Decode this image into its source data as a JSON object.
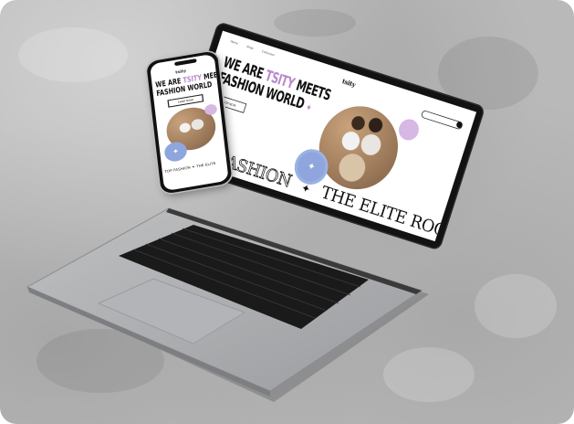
{
  "scene": {
    "description_free": true,
    "colors": {
      "concrete": "#b9b9b9",
      "accent_lilac": "#d7b7e3",
      "accent_blue": "#8ea6dd",
      "screen_bezel": "#121212",
      "laptop_silver": "#a9a9ab"
    }
  },
  "laptop_site": {
    "nav": [
      "Home",
      "Shop",
      "Collection"
    ],
    "brand": "tsity",
    "hero_line1_a": "WE ARE ",
    "hero_line1_accent": "TSITY",
    "hero_line1_b": " MEETS",
    "hero_line2": "FASHION WORLD",
    "hero_sparkle": "✦",
    "hero_button": "SHOP NOW",
    "badge_icon": "✦",
    "ticker_left": "TOP FASHION",
    "ticker_star": "✦",
    "ticker_right": "THE ELITE ROCKET"
  },
  "phone_site": {
    "brand": "tsity",
    "title_line1_a": "WE ARE ",
    "title_line1_accent": "TSITY",
    "title_line1_b": " MEETS",
    "title_line2": "FASHION WORLD",
    "button": "SHOP NOW",
    "badge_icon": "✦",
    "ticker": "TOP FASHION ✦ THE ELITE"
  }
}
